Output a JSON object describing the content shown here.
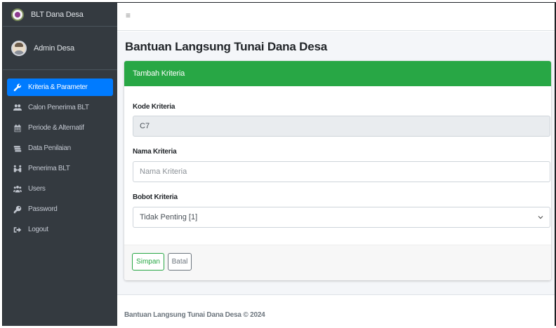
{
  "brand": {
    "title": "BLT Dana Desa"
  },
  "user": {
    "name": "Admin Desa"
  },
  "sidebar": {
    "items": [
      {
        "label": "Kriteria & Parameter",
        "icon": "wrench-icon",
        "active": true
      },
      {
        "label": "Calon Penerima BLT",
        "icon": "users-icon"
      },
      {
        "label": "Periode & Alternatif",
        "icon": "calendar-icon"
      },
      {
        "label": "Data Penilaian",
        "icon": "money-icon"
      },
      {
        "label": "Penerima BLT",
        "icon": "people-arrows-icon"
      },
      {
        "label": "Users",
        "icon": "user-group-icon"
      },
      {
        "label": "Password",
        "icon": "key-icon"
      },
      {
        "label": "Logout",
        "icon": "sign-out-icon"
      }
    ]
  },
  "header": {
    "menu_icon": "hamburger-icon"
  },
  "page": {
    "title": "Bantuan Langsung Tunai Dana Desa"
  },
  "card": {
    "title": "Tambah Kriteria",
    "kode_label": "Kode Kriteria",
    "kode_value": "C7",
    "nama_label": "Nama Kriteria",
    "nama_placeholder": "Nama Kriteria",
    "bobot_label": "Bobot Kriteria",
    "bobot_value": "Tidak Penting [1]",
    "save_label": "Simpan",
    "cancel_label": "Batal"
  },
  "footer": {
    "text": "Bantuan Langsung Tunai Dana Desa © 2024"
  },
  "colors": {
    "sidebar_bg": "#343a40",
    "active_item": "#007bff",
    "card_header": "#28a745",
    "content_bg": "#f4f6f9"
  }
}
